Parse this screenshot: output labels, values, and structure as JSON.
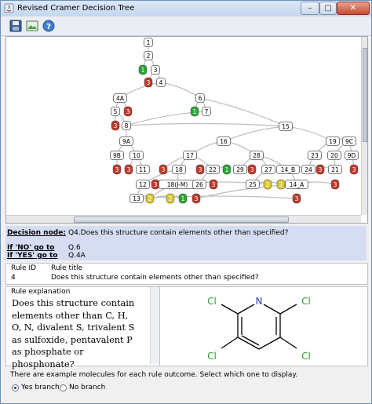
{
  "window": {
    "title": "Revised Cramer Decision Tree",
    "controls": [
      "–",
      "□",
      "✕"
    ]
  },
  "toolbar": {
    "icons": [
      "save-icon",
      "image-icon",
      "help-icon"
    ]
  },
  "tree": {
    "edge_color": "#bdbdbd",
    "node_colors": {
      "green": "#2fa33a",
      "red": "#c0392b",
      "yellow": "#d8c832"
    },
    "nodes": [
      {
        "id": "n1",
        "label": "1",
        "kind": "box"
      },
      {
        "id": "n2",
        "label": "2",
        "kind": "box"
      },
      {
        "id": "g1",
        "label": "1",
        "kind": "green"
      },
      {
        "id": "n3",
        "label": "3",
        "kind": "box"
      },
      {
        "id": "r3",
        "label": "3",
        "kind": "red"
      },
      {
        "id": "n4",
        "label": "4",
        "kind": "box"
      },
      {
        "id": "n4a",
        "label": "4A",
        "kind": "box"
      },
      {
        "id": "n6",
        "label": "6",
        "kind": "box"
      },
      {
        "id": "n5",
        "label": "5",
        "kind": "box"
      },
      {
        "id": "r3b",
        "label": "3",
        "kind": "red"
      },
      {
        "id": "g1b",
        "label": "1",
        "kind": "green"
      },
      {
        "id": "n7",
        "label": "7",
        "kind": "box"
      },
      {
        "id": "r3c",
        "label": "3",
        "kind": "red"
      },
      {
        "id": "n8",
        "label": "8",
        "kind": "box"
      },
      {
        "id": "n15",
        "label": "15",
        "kind": "box"
      },
      {
        "id": "n9a",
        "label": "9A",
        "kind": "box"
      },
      {
        "id": "n16",
        "label": "16",
        "kind": "box"
      },
      {
        "id": "n19",
        "label": "19",
        "kind": "box"
      },
      {
        "id": "n9c",
        "label": "9C",
        "kind": "box"
      },
      {
        "id": "n9b",
        "label": "9B",
        "kind": "box"
      },
      {
        "id": "n10",
        "label": "10",
        "kind": "box"
      },
      {
        "id": "n17",
        "label": "17",
        "kind": "box"
      },
      {
        "id": "n28",
        "label": "28",
        "kind": "box"
      },
      {
        "id": "n23",
        "label": "23",
        "kind": "box"
      },
      {
        "id": "n20",
        "label": "20",
        "kind": "box"
      },
      {
        "id": "n9d",
        "label": "9D",
        "kind": "box"
      },
      {
        "id": "r3d",
        "label": "3",
        "kind": "red"
      },
      {
        "id": "r3e",
        "label": "3",
        "kind": "red"
      },
      {
        "id": "n11",
        "label": "11",
        "kind": "box"
      },
      {
        "id": "r3f",
        "label": "3",
        "kind": "red"
      },
      {
        "id": "n18",
        "label": "18",
        "kind": "box"
      },
      {
        "id": "r3g",
        "label": "3",
        "kind": "red"
      },
      {
        "id": "n22",
        "label": "22",
        "kind": "box"
      },
      {
        "id": "g1c",
        "label": "1",
        "kind": "green"
      },
      {
        "id": "n29",
        "label": "29",
        "kind": "box"
      },
      {
        "id": "r3h",
        "label": "3",
        "kind": "red"
      },
      {
        "id": "n27",
        "label": "27",
        "kind": "box"
      },
      {
        "id": "n14b",
        "label": "14_B",
        "kind": "box"
      },
      {
        "id": "n24",
        "label": "24",
        "kind": "box"
      },
      {
        "id": "r3i",
        "label": "3",
        "kind": "red"
      },
      {
        "id": "n21",
        "label": "21",
        "kind": "box"
      },
      {
        "id": "r3j",
        "label": "3",
        "kind": "red"
      },
      {
        "id": "n12",
        "label": "12",
        "kind": "box"
      },
      {
        "id": "r3k",
        "label": "3",
        "kind": "red"
      },
      {
        "id": "n18jm",
        "label": "18(J-M)",
        "kind": "box"
      },
      {
        "id": "n26",
        "label": "26",
        "kind": "box"
      },
      {
        "id": "r3l",
        "label": "3",
        "kind": "red"
      },
      {
        "id": "n25",
        "label": "25",
        "kind": "box"
      },
      {
        "id": "y2a",
        "label": "2",
        "kind": "yellow"
      },
      {
        "id": "y2b",
        "label": "2",
        "kind": "yellow"
      },
      {
        "id": "n14a",
        "label": "14_A",
        "kind": "box"
      },
      {
        "id": "r3m",
        "label": "3",
        "kind": "red"
      },
      {
        "id": "n13",
        "label": "13",
        "kind": "box"
      },
      {
        "id": "y2c",
        "label": "2",
        "kind": "yellow"
      },
      {
        "id": "y2d",
        "label": "2",
        "kind": "yellow"
      },
      {
        "id": "g1d",
        "label": "1",
        "kind": "green"
      },
      {
        "id": "r3n",
        "label": "3",
        "kind": "red"
      },
      {
        "id": "r3o",
        "label": "3",
        "kind": "red"
      }
    ],
    "edges": [
      [
        "n1",
        "n2"
      ],
      [
        "n2",
        "g1"
      ],
      [
        "n2",
        "n3"
      ],
      [
        "n3",
        "r3"
      ],
      [
        "n3",
        "n4"
      ],
      [
        "n4",
        "n4a"
      ],
      [
        "n4",
        "n6"
      ],
      [
        "n4a",
        "n5"
      ],
      [
        "n4a",
        "r3b"
      ],
      [
        "n5",
        "r3c"
      ],
      [
        "n5",
        "n8"
      ],
      [
        "n6",
        "g1b"
      ],
      [
        "n6",
        "n7"
      ],
      [
        "n6",
        "n15"
      ],
      [
        "n7",
        "n8"
      ],
      [
        "n8",
        "n15"
      ],
      [
        "n8",
        "n9a"
      ],
      [
        "n15",
        "n16"
      ],
      [
        "n15",
        "n19"
      ],
      [
        "n19",
        "n9c"
      ],
      [
        "n19",
        "n23"
      ],
      [
        "n9c",
        "n20"
      ],
      [
        "n9c",
        "n9d"
      ],
      [
        "n9a",
        "n9b"
      ],
      [
        "n9a",
        "n10"
      ],
      [
        "n9b",
        "r3d"
      ],
      [
        "n10",
        "r3e"
      ],
      [
        "n10",
        "n11"
      ],
      [
        "n16",
        "n17"
      ],
      [
        "n16",
        "n28"
      ],
      [
        "n17",
        "n18"
      ],
      [
        "n17",
        "r3f"
      ],
      [
        "n17",
        "n22"
      ],
      [
        "n28",
        "n29"
      ],
      [
        "n28",
        "n27"
      ],
      [
        "n28",
        "n14b"
      ],
      [
        "n23",
        "n24"
      ],
      [
        "n20",
        "n21"
      ],
      [
        "n9d",
        "r3j"
      ],
      [
        "n21",
        "r3i"
      ],
      [
        "n18",
        "n18jm"
      ],
      [
        "n18",
        "n12"
      ],
      [
        "n22",
        "g1c"
      ],
      [
        "n29",
        "r3h"
      ],
      [
        "n27",
        "n25"
      ],
      [
        "n14b",
        "n14a"
      ],
      [
        "n24",
        "n14b"
      ],
      [
        "n12",
        "r3k"
      ],
      [
        "n12",
        "n13"
      ],
      [
        "n18jm",
        "y2a"
      ],
      [
        "n18jm",
        "y2c"
      ],
      [
        "n26",
        "r3l"
      ],
      [
        "n25",
        "y2b"
      ],
      [
        "n14a",
        "r3m"
      ],
      [
        "n13",
        "y2c"
      ],
      [
        "n13",
        "r3o"
      ],
      [
        "y2c",
        "g1d"
      ],
      [
        "g1d",
        "y2d"
      ],
      [
        "n14a",
        "r3n"
      ],
      [
        "n22",
        "n26"
      ]
    ]
  },
  "decision_node": {
    "label": "Decision node:",
    "text": "Q4.Does this structure contain elements other than specified?",
    "no_label": "If 'NO' go to",
    "no_target": "Q.6",
    "yes_label": "If 'YES' go to",
    "yes_target": "Q.4A"
  },
  "rule": {
    "id_header": "Rule ID",
    "title_header": "Rule title",
    "id_value": "4",
    "title_value": "Does this structure contain elements other than specified?"
  },
  "explanation": {
    "header": "Rule explanation",
    "text": "Does this structure contain elements other than C, H, O, N, divalent S, trivalent S as sulfoxide, pentavalent P as phosphate or phosphonate?"
  },
  "molecule": {
    "atoms": [
      "N",
      "Cl",
      "Cl",
      "Cl",
      "Cl"
    ],
    "cl_color": "#2e9c2e",
    "n_color": "#2b3fb8"
  },
  "footer": {
    "note": "There are example molecules for each rule outcome. Select which one to display.",
    "radio_yes": "Yes branch",
    "radio_no": "No branch",
    "selected": "Yes branch"
  }
}
